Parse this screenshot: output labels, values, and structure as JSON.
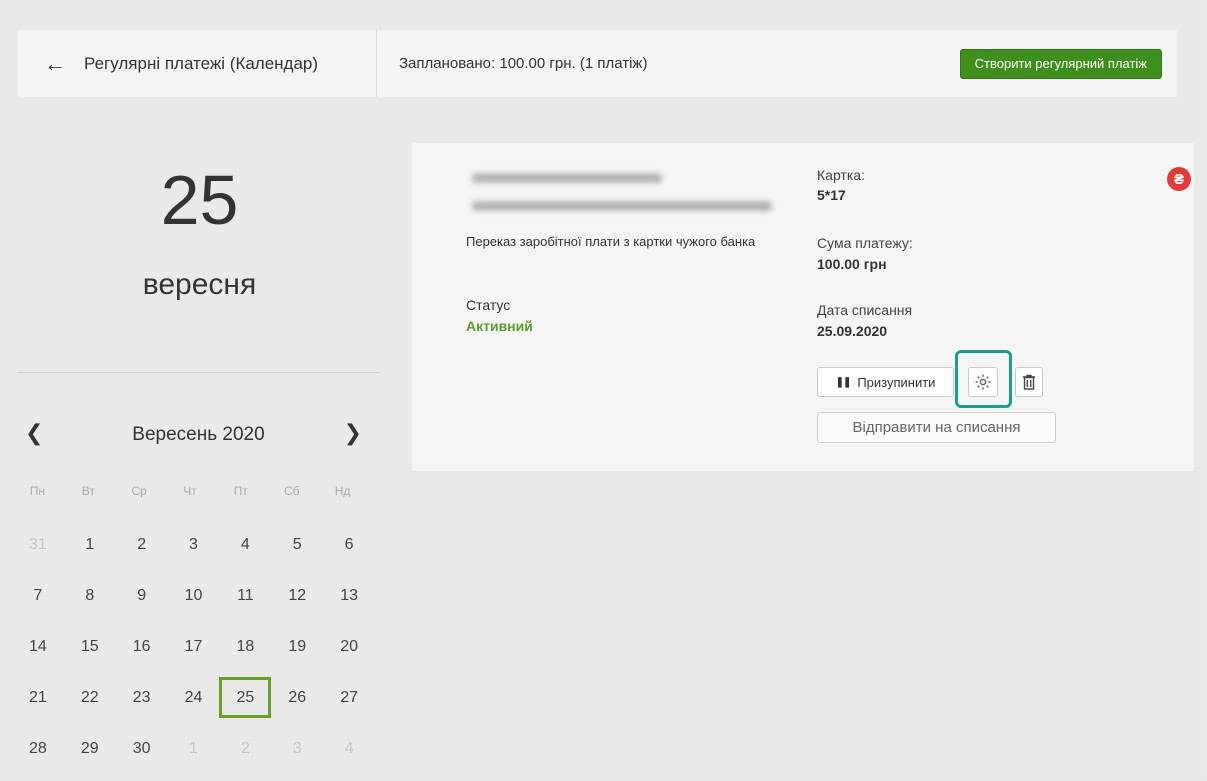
{
  "header": {
    "back_title": "Регулярні платежі (Календар)",
    "planned_summary": "Заплановано: 100.00 грн. (1 платіж)",
    "create_button": "Створити регулярний платіж"
  },
  "selected_date": {
    "day": "25",
    "month": "вересня"
  },
  "calendar": {
    "title": "Вересень 2020",
    "weekdays": [
      "Пн",
      "Вт",
      "Ср",
      "Чт",
      "Пт",
      "Сб",
      "Нд"
    ],
    "weeks": [
      [
        "31",
        "1",
        "2",
        "3",
        "4",
        "5",
        "6"
      ],
      [
        "7",
        "8",
        "9",
        "10",
        "11",
        "12",
        "13"
      ],
      [
        "14",
        "15",
        "16",
        "17",
        "18",
        "19",
        "20"
      ],
      [
        "21",
        "22",
        "23",
        "24",
        "25",
        "26",
        "27"
      ],
      [
        "28",
        "29",
        "30",
        "1",
        "2",
        "3",
        "4"
      ]
    ]
  },
  "payment": {
    "description": "Переказ заробітної плати з картки чужого банка",
    "status_label": "Статус",
    "status_value": "Активний",
    "card_label": "Картка:",
    "card_value": "5*17",
    "amount_label": "Сума платежу:",
    "amount_value": "100.00 грн",
    "date_label": "Дата списання",
    "date_value": "25.09.2020",
    "currency_badge": "₴",
    "pause_button": "Призупинити",
    "submit_button": "Відправити на списання"
  },
  "colors": {
    "accent_green": "#3f8f1e",
    "status_green": "#5a9e2a",
    "highlight_teal": "#18a08a",
    "badge_red": "#e23b3b"
  }
}
